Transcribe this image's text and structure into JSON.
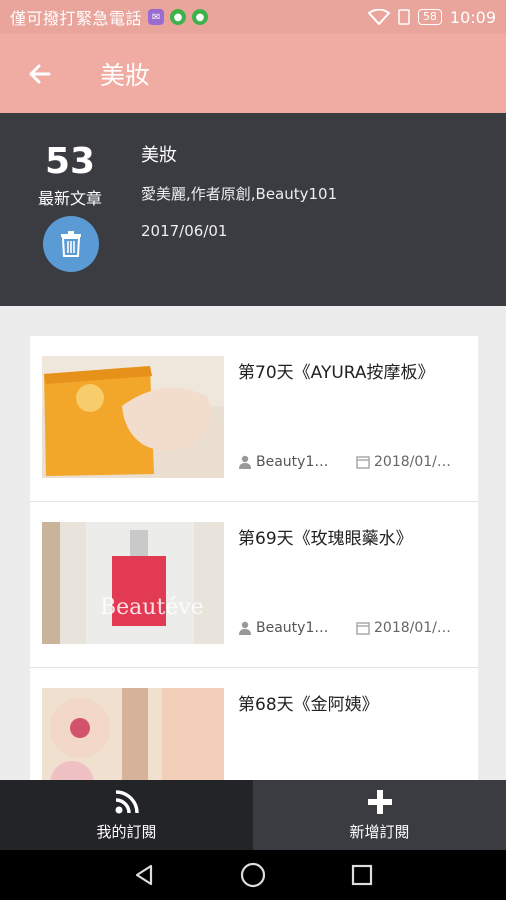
{
  "status_bar": {
    "carrier": "僅可撥打緊急電話",
    "battery": "58",
    "time": "10:09"
  },
  "app_bar": {
    "title": "美妝"
  },
  "info": {
    "count": "53",
    "count_label": "最新文章",
    "name": "美妝",
    "authors": "愛美麗,作者原創,Beauty101",
    "date": "2017/06/01"
  },
  "articles": [
    {
      "title": "第70天《AYURA按摩板》",
      "author": "Beauty1…",
      "date": "2018/01/…"
    },
    {
      "title": "第69天《玫瑰眼藥水》",
      "author": "Beauty1…",
      "date": "2018/01/…"
    },
    {
      "title": "第68天《金阿姨》",
      "author": "",
      "date": ""
    }
  ],
  "tabs": {
    "subscriptions": "我的訂閱",
    "add": "新增訂閱"
  },
  "colors": {
    "status_bar": "#e9a49c",
    "app_bar": "#f0aca3",
    "info_panel": "#3a3c42",
    "delete_button": "#5b9bd5"
  }
}
